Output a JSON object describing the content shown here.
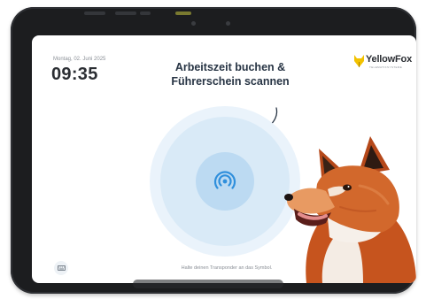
{
  "screen": {
    "date": "Montag, 02. Juni 2025",
    "time": "09:35",
    "headline_line1": "Arbeitszeit buchen &",
    "headline_line2": "Führerschein scannen",
    "hint": "Halte deinen Transponder an das Symbol.",
    "brand": {
      "name": "YellowFox",
      "tagline": "TELEMATIKSYSTEME"
    },
    "icons": {
      "scan": "nfc-scan-icon",
      "keyboard": "keyboard-icon",
      "settings": "gear-icon",
      "arrow": "arrow-down-icon"
    }
  },
  "colors": {
    "brand_yellow": "#f2c200",
    "ring_outer": "#eaf3fb",
    "ring_middle": "#d9eaf7",
    "ring_inner": "#bcdaf2",
    "icon_blue": "#2f8fdc",
    "text_dark": "#273444",
    "tablet_frame": "#1c1d1f"
  }
}
